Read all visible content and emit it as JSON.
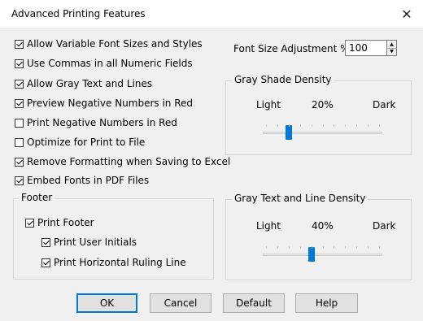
{
  "window": {
    "title": "Advanced Printing Features",
    "close_glyph": "✕"
  },
  "options": [
    {
      "label": "Allow Variable Font Sizes and Styles",
      "checked": true
    },
    {
      "label": "Use Commas in all Numeric Fields",
      "checked": true
    },
    {
      "label": "Allow Gray Text and Lines",
      "checked": true
    },
    {
      "label": "Preview Negative Numbers in Red",
      "checked": true
    },
    {
      "label": "Print Negative Numbers in Red",
      "checked": false
    },
    {
      "label": "Optimize for Print to File",
      "checked": false
    },
    {
      "label": "Remove Formatting when Saving to Excel",
      "checked": true
    },
    {
      "label": "Embed Fonts in PDF Files",
      "checked": true
    }
  ],
  "font_size_adjustment": {
    "label": "Font Size Adjustment %:",
    "value": "100"
  },
  "gray_shade": {
    "title": "Gray Shade Density",
    "min_label": "Light",
    "max_label": "Dark",
    "value_label": "20%",
    "value_fraction": 0.2
  },
  "gray_text": {
    "title": "Gray Text and Line Density",
    "min_label": "Light",
    "max_label": "Dark",
    "value_label": "40%",
    "value_fraction": 0.4
  },
  "footer": {
    "title": "Footer",
    "print_footer": {
      "label": "Print Footer",
      "checked": true
    },
    "user_initials": {
      "label": "Print User Initials",
      "checked": true
    },
    "ruling_line": {
      "label": "Print Horizontal Ruling Line",
      "checked": true
    }
  },
  "buttons": {
    "ok": "OK",
    "cancel": "Cancel",
    "default": "Default",
    "help": "Help"
  },
  "colors": {
    "accent": "#0078d7",
    "dialog_bg": "#f0f0f0"
  }
}
